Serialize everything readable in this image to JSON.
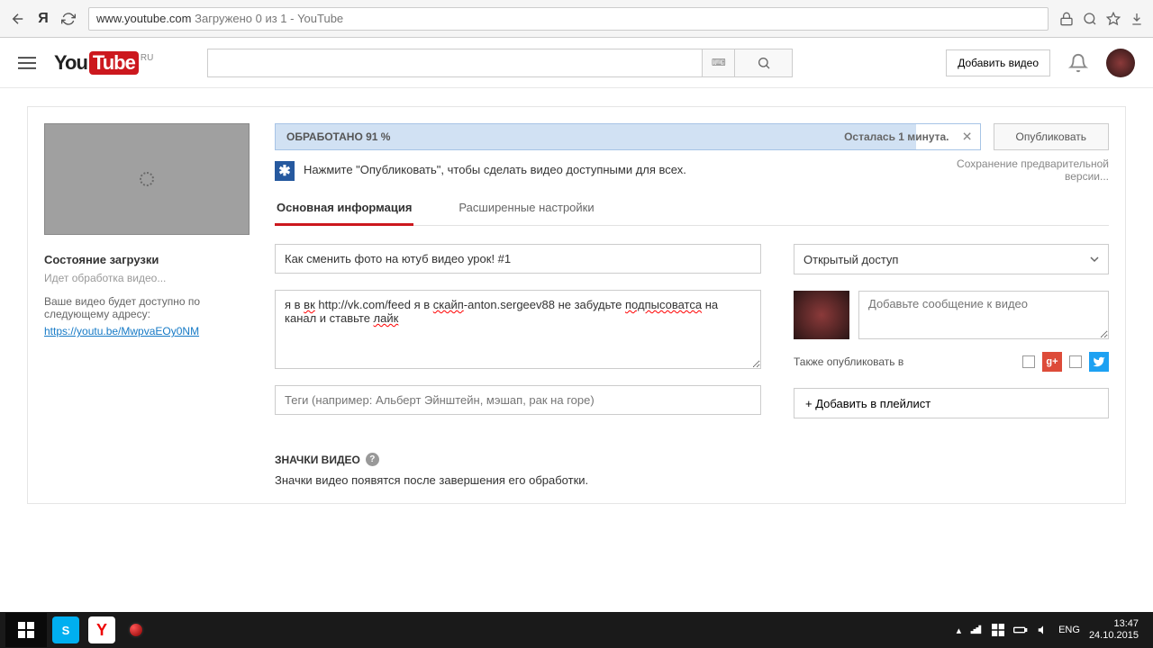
{
  "browser": {
    "url_domain": "www.youtube.com",
    "url_rest": "  Загружено 0 из 1 - YouTube"
  },
  "header": {
    "logo_region": "RU",
    "upload_button": "Добавить видео"
  },
  "sidebar": {
    "status_title": "Состояние загрузки",
    "status_sub": "Идет обработка видео...",
    "status_desc": "Ваше видео будет доступно по следующему адресу:",
    "video_link": "https://youtu.be/MwpvaEOy0NM"
  },
  "progress": {
    "label": "ОБРАБОТАНО 91 %",
    "time": "Осталась 1 минута.",
    "publish": "Опубликовать"
  },
  "info": {
    "text": "Нажмите \"Опубликовать\", чтобы сделать видео доступными для всех.",
    "saving": "Сохранение предварительной версии..."
  },
  "tabs": {
    "basic": "Основная информация",
    "advanced": "Расширенные настройки"
  },
  "form": {
    "title": "Как сменить фото на ютуб видео урок! #1",
    "desc_p1": "я в ",
    "desc_w1": "вк",
    "desc_p2": " http://vk.com/feed я в ",
    "desc_w2": "скайп",
    "desc_p3": "-anton.sergeev88 не забудьте ",
    "desc_w3": "подпысоватса",
    "desc_p4": " на канал и ставьте ",
    "desc_w4": "лайк",
    "tags_placeholder": "Теги (например: Альберт Эйнштейн, мэшап, рак на горе)"
  },
  "side": {
    "privacy": "Открытый доступ",
    "share_placeholder": "Добавьте сообщение к видео",
    "also_label": "Также опубликовать в",
    "playlist": "+ Добавить в плейлист"
  },
  "thumbs": {
    "title": "ЗНАЧКИ ВИДЕО",
    "desc": "Значки видео появятся после завершения его обработки."
  },
  "taskbar": {
    "lang": "ENG",
    "time": "13:47",
    "date": "24.10.2015"
  }
}
